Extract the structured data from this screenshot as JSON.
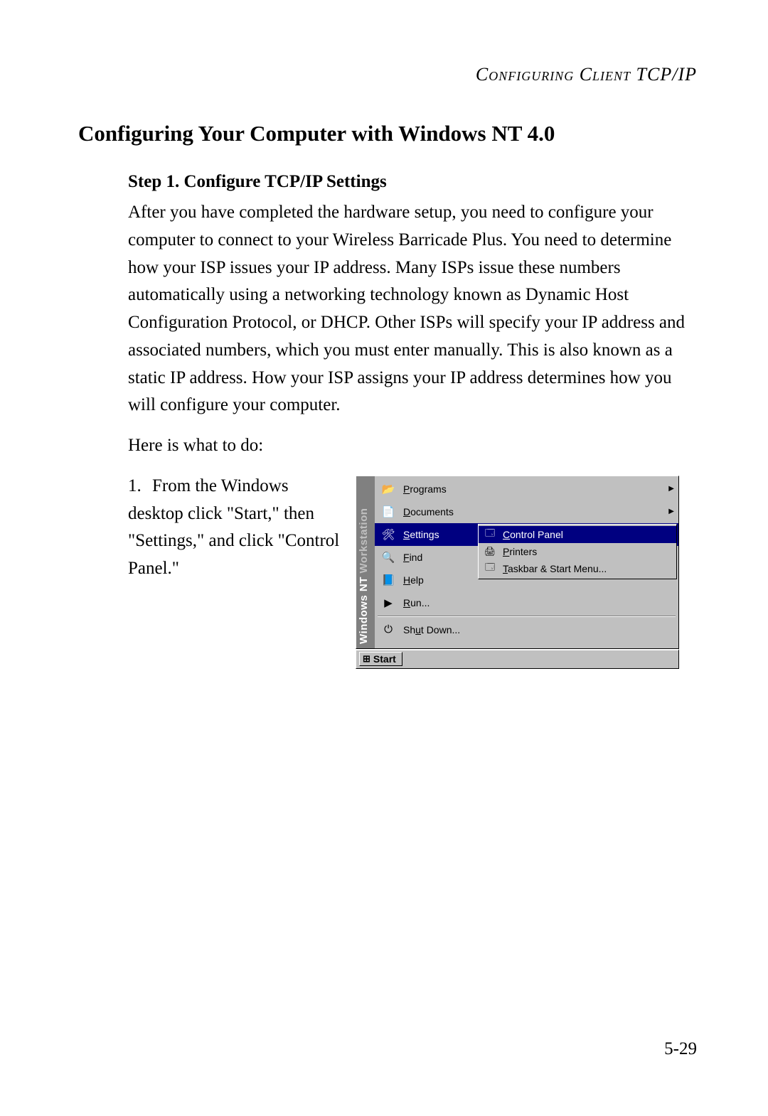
{
  "running_head": "Configuring Client TCP/IP",
  "section_title": "Configuring Your Computer with Windows NT 4.0",
  "step_heading": "Step 1. Configure TCP/IP Settings",
  "paragraph1": "After you have completed the hardware setup, you need to configure your computer to connect to your Wireless Barricade Plus. You need to determine how your ISP issues your IP address. Many ISPs issue these numbers automatically using a networking technology known as Dynamic Host Configuration Protocol, or DHCP. Other ISPs will specify your IP address and associated numbers, which you must enter manually. This is also known as a static IP address. How your ISP assigns your IP address determines how you will configure your computer.",
  "paragraph2": "Here is what to do:",
  "step1_number": "1.",
  "step1_text": "From the Windows desktop click \"Start,\" then \"Settings,\" and click \"Control Panel.\"",
  "startmenu": {
    "banner_part1": "Windows NT",
    "banner_part2": " Workstation",
    "items": [
      {
        "icon": "📂",
        "underline": "P",
        "rest": "rograms",
        "arrow": true,
        "selected": false
      },
      {
        "icon": "📄",
        "underline": "D",
        "rest": "ocuments",
        "arrow": true,
        "selected": false
      },
      {
        "icon": "🛠",
        "underline": "S",
        "rest": "ettings",
        "arrow": true,
        "selected": true
      },
      {
        "icon": "🔍",
        "underline": "F",
        "rest": "ind",
        "arrow": true,
        "selected": false
      },
      {
        "icon": "📘",
        "underline": "H",
        "rest": "elp",
        "arrow": false,
        "selected": false
      },
      {
        "icon": "▶",
        "underline": "R",
        "rest": "un...",
        "arrow": false,
        "selected": false
      },
      {
        "icon": "⏻",
        "underline": "",
        "rest": "Shut Down...",
        "arrow": false,
        "selected": false,
        "ul_mid": "u",
        "prefix": "Sh",
        "suffix": "t Down..."
      }
    ],
    "submenu": [
      {
        "icon": "🗔",
        "underline": "C",
        "rest": "ontrol Panel",
        "selected": true
      },
      {
        "icon": "🖨",
        "underline": "P",
        "rest": "rinters",
        "selected": false
      },
      {
        "icon": "🗔",
        "underline": "T",
        "rest": "askbar & Start Menu...",
        "selected": false
      }
    ],
    "start_button": "Start"
  },
  "page_number": "5-29"
}
